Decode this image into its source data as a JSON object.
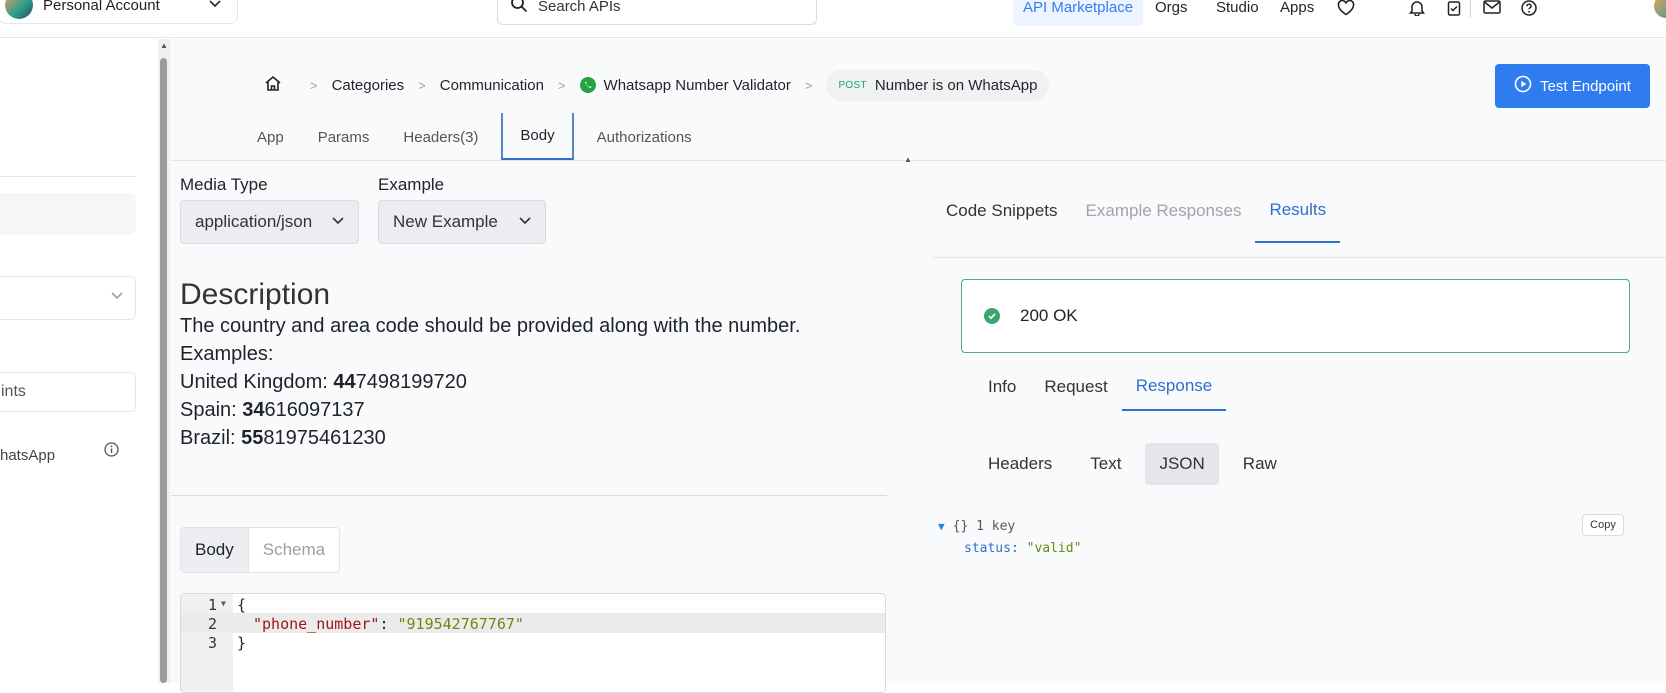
{
  "topbar": {
    "account": {
      "name": "Personal Account"
    },
    "search": {
      "placeholder": "Search APIs"
    },
    "nav": [
      {
        "label": "API Marketplace",
        "active": true
      },
      {
        "label": "Orgs"
      },
      {
        "label": "Studio"
      },
      {
        "label": "Apps"
      }
    ],
    "icons": [
      "heart-icon",
      "bell-icon",
      "clipboard-check-icon",
      "mail-icon",
      "help-icon"
    ]
  },
  "left_panel": {
    "search_placeholder": "ints",
    "endpoint_item": "hatsApp"
  },
  "breadcrumb": {
    "home_icon": "home-icon",
    "items": [
      "Categories",
      "Communication",
      "Whatsapp Number Validator"
    ],
    "method": "POST",
    "endpoint": "Number is on WhatsApp"
  },
  "test_endpoint": {
    "label": "Test Endpoint"
  },
  "request_tabs": [
    "App",
    "Params",
    "Headers(3)",
    "Body",
    "Authorizations"
  ],
  "body": {
    "media_type_label": "Media Type",
    "media_type_value": "application/json",
    "example_label": "Example",
    "example_value": "New Example",
    "description_title": "Description",
    "description_lines": [
      {
        "prefix": "The country and area code should be provided along with the number.",
        "bold": "",
        "rest": ""
      },
      {
        "prefix": "Examples:",
        "bold": "",
        "rest": ""
      },
      {
        "prefix": "United Kingdom: ",
        "bold": "44",
        "rest": "7498199720"
      },
      {
        "prefix": "Spain: ",
        "bold": "34",
        "rest": "616097137"
      },
      {
        "prefix": "Brazil: ",
        "bold": "55",
        "rest": "81975461230"
      }
    ],
    "segments": [
      "Body",
      "Schema"
    ],
    "code": {
      "line_numbers": [
        "1",
        "2",
        "3"
      ],
      "open": "{",
      "key": "\"phone_number\"",
      "colon": ": ",
      "value": "\"919542767767\"",
      "close": "}"
    }
  },
  "results": {
    "tabs": [
      "Code Snippets",
      "Example Responses",
      "Results"
    ],
    "status": "200 OK",
    "status_color": "#3aa76d",
    "sub_tabs": [
      "Info",
      "Request",
      "Response"
    ],
    "formats": [
      "Headers",
      "Text",
      "JSON",
      "Raw"
    ],
    "json_summary": "{} 1 key",
    "json_key": "status:",
    "json_value": "\"valid\"",
    "copy_label": "Copy"
  },
  "colors": {
    "accent": "#2f7bf0",
    "success": "#4caf7d"
  }
}
